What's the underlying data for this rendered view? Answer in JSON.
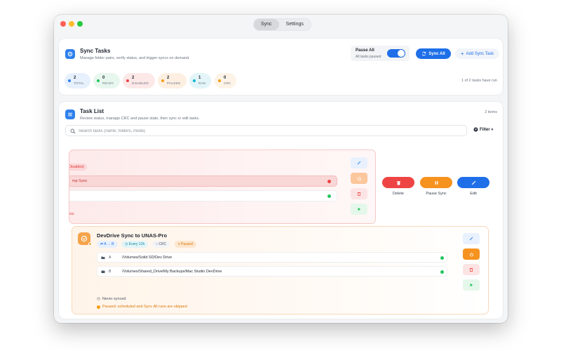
{
  "titlebar": {
    "tabs": [
      {
        "label": "Sync",
        "active": true
      },
      {
        "label": "Settings",
        "active": false
      }
    ]
  },
  "sync_tasks": {
    "title": "Sync Tasks",
    "subtitle": "Manage folder pairs, verify status, and trigger syncs on demand.",
    "pause_all": {
      "label": "Pause All",
      "status": "All tasks paused",
      "on": true
    },
    "sync_all_label": "Sync All",
    "add_task_label": "Add Sync Task",
    "stats": [
      {
        "value": "2",
        "label": "TOTAL",
        "color": "#2f80ed",
        "bg": "#e7f0fd"
      },
      {
        "value": "0",
        "label": "READY",
        "color": "#22c55e",
        "bg": "#e8f7ee"
      },
      {
        "value": "2",
        "label": "DISABLED",
        "color": "#ef4444",
        "bg": "#fde8e8"
      },
      {
        "value": "2",
        "label": "PAUSED",
        "color": "#f59e0b",
        "bg": "#fdf0e2"
      },
      {
        "value": "1",
        "label": "RAN",
        "color": "#06b6d4",
        "bg": "#e3f5f8"
      },
      {
        "value": "0",
        "label": "CRC",
        "color": "#f59e0b",
        "bg": "#fdf3e6"
      }
    ],
    "run_status": "1 of 2 tasks have run"
  },
  "task_list": {
    "title": "Task List",
    "subtitle": "Review status, manage CRC and pause state, then sync or edit tasks.",
    "count": "2 items",
    "search_placeholder": "Search tasks (name, folders, mode)",
    "filter_label": "Filter"
  },
  "task_a": {
    "disabled_chip": "Disabled",
    "name_fragment": "mp Sync",
    "error_fragment": "ess"
  },
  "swipe_actions": [
    {
      "label": "Delete",
      "color": "#ef4444"
    },
    {
      "label": "Pause Sync",
      "color": "#f59e0b"
    },
    {
      "label": "Edit",
      "color": "#1e6fe8"
    }
  ],
  "task_b": {
    "title": "DevDrive Sync to UNAS-Pro",
    "chips": {
      "direction": "A → B",
      "schedule": "Every 12h",
      "crc": "CRC",
      "state": "Paused"
    },
    "paths": [
      {
        "key": "A",
        "value": "/Volumes/Solid SD/Dev Drive"
      },
      {
        "key": "B",
        "value": "/Volumes/Shared_Drive/My Backups/Mac Studio DevDrive"
      }
    ],
    "last_sync": "Never synced",
    "paused_note": "Paused: scheduled and Sync All runs are skipped"
  }
}
